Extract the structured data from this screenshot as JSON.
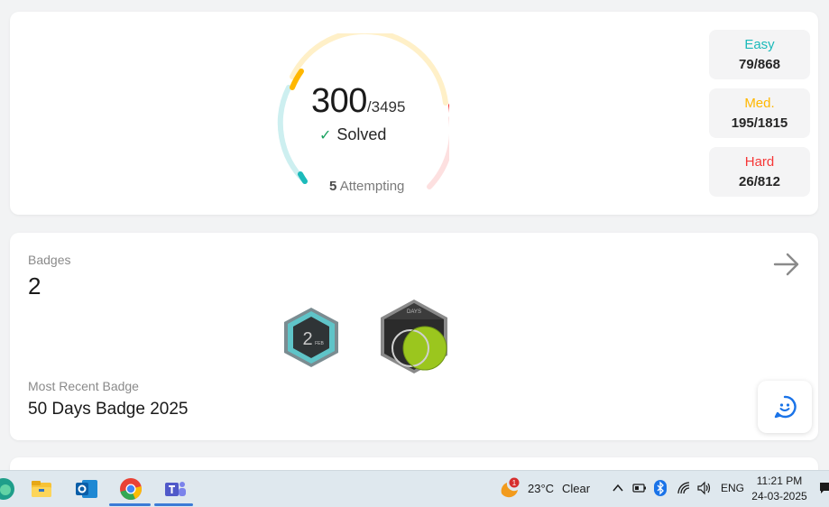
{
  "progress": {
    "solved": "300",
    "total": "/3495",
    "solved_label": "Solved",
    "attempting_count": "5",
    "attempting_label": "Attempting",
    "difficulties": [
      {
        "name": "Easy",
        "value": "79/868",
        "color": "#1cbaba"
      },
      {
        "name": "Med.",
        "value": "195/1815",
        "color": "#ffb700"
      },
      {
        "name": "Hard",
        "value": "26/812",
        "color": "#f63737"
      }
    ]
  },
  "badges": {
    "title": "Badges",
    "count": "2",
    "recent_title": "Most Recent Badge",
    "recent_name": "50 Days Badge 2025",
    "badge1_text": "2",
    "badge1_sub": "FEB",
    "badge2_text": "DAYS"
  },
  "taskbar": {
    "weather_temp": "23°C",
    "weather_cond": "Clear",
    "weather_badge": "1",
    "lang": "ENG",
    "time": "11:21 PM",
    "date": "24-03-2025"
  }
}
